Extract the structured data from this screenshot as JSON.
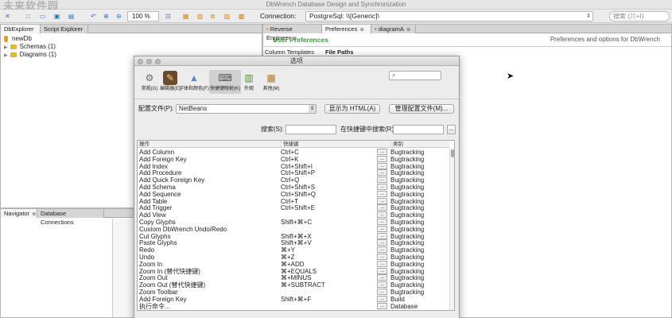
{
  "window": {
    "title": "DbWrench Database Design and Synchronization",
    "watermark": "未来软件园"
  },
  "toolbar": {
    "zoom_value": "100 %",
    "connection_label": "Connection:",
    "connection_value": "PostgreSql: \\\\[Generic]\\",
    "search_placeholder": "搜索 (⌘+I)"
  },
  "left_top_panel": {
    "tabs": [
      {
        "label": "DbExplorer"
      },
      {
        "label": "Script Explorer"
      }
    ],
    "tree": {
      "db": "newDb",
      "schemas": "Schemas (1)",
      "diagrams": "Diagrams (1)"
    }
  },
  "left_bottom_panel": {
    "tabs": [
      {
        "label": "Navigator"
      },
      {
        "label": "Database Connections"
      }
    ]
  },
  "right_panel": {
    "tabs": [
      {
        "label": "Reverse Engineer"
      },
      {
        "label": "Preferences"
      },
      {
        "label": "diagramA"
      }
    ],
    "title": "User Preferences",
    "subtitle": "Preferences and options for DbWrench",
    "col1": "Column Templates",
    "col2": "File Paths"
  },
  "dialog": {
    "title": "选项",
    "categories": [
      {
        "label": "常规(G)"
      },
      {
        "label": "编辑器(E)"
      },
      {
        "label": "字体和颜色(F)"
      },
      {
        "label": "快捷键映射(K)"
      },
      {
        "label": "外观"
      },
      {
        "label": "其他(M)"
      }
    ],
    "profile_label": "配置文件(P):",
    "profile_value": "NetBeans",
    "show_html_button": "显示为 HTML(A)",
    "manage_profiles_button": "管理配置文件(M)...",
    "search_label": "搜索(S):",
    "search_shortcut_label": "在快捷键中搜索(R):",
    "more_button": "...",
    "columns": {
      "action": "操作",
      "shortcut": "快捷键",
      "category": "类别"
    },
    "rows": [
      {
        "action": "Add Column",
        "shortcut": "Ctrl+C",
        "category": "Bugtracking"
      },
      {
        "action": "Add Foreign Key",
        "shortcut": "Ctrl+K",
        "category": "Bugtracking"
      },
      {
        "action": "Add Index",
        "shortcut": "Ctrl+Shift+I",
        "category": "Bugtracking"
      },
      {
        "action": "Add Procedure",
        "shortcut": "Ctrl+Shift+P",
        "category": "Bugtracking"
      },
      {
        "action": "Add Quick Foreign Key",
        "shortcut": "Ctrl+Q",
        "category": "Bugtracking"
      },
      {
        "action": "Add Schema",
        "shortcut": "Ctrl+Shift+S",
        "category": "Bugtracking"
      },
      {
        "action": "Add Sequence",
        "shortcut": "Ctrl+Shift+Q",
        "category": "Bugtracking"
      },
      {
        "action": "Add Table",
        "shortcut": "Ctrl+T",
        "category": "Bugtracking"
      },
      {
        "action": "Add Trigger",
        "shortcut": "Ctrl+Shift+E",
        "category": "Bugtracking"
      },
      {
        "action": "Add View",
        "shortcut": "",
        "category": "Bugtracking"
      },
      {
        "action": "Copy Glyphs",
        "shortcut": "Shift+⌘+C",
        "category": "Bugtracking"
      },
      {
        "action": "Custom DbWrench Undo/Redo",
        "shortcut": "",
        "category": "Bugtracking"
      },
      {
        "action": "Cut Glyphs",
        "shortcut": "Shift+⌘+X",
        "category": "Bugtracking"
      },
      {
        "action": "Paste Glyphs",
        "shortcut": "Shift+⌘+V",
        "category": "Bugtracking"
      },
      {
        "action": "Redo",
        "shortcut": "⌘+Y",
        "category": "Bugtracking"
      },
      {
        "action": "Undo",
        "shortcut": "⌘+Z",
        "category": "Bugtracking"
      },
      {
        "action": "Zoom In",
        "shortcut": "⌘+ADD",
        "category": "Bugtracking"
      },
      {
        "action": "Zoom In (替代快捷键)",
        "shortcut": "⌘+EQUALS",
        "category": "Bugtracking"
      },
      {
        "action": "Zoom Out",
        "shortcut": "⌘+MINUS",
        "category": "Bugtracking"
      },
      {
        "action": "Zoom Out (替代快捷键)",
        "shortcut": "⌘+SUBTRACT",
        "category": "Bugtracking"
      },
      {
        "action": "Zoom Toolbar",
        "shortcut": "",
        "category": "Bugtracking"
      },
      {
        "action": "Add Foreign Key",
        "shortcut": "Shift+⌘+F",
        "category": "Build"
      },
      {
        "action": "执行命令...",
        "shortcut": "",
        "category": "Database"
      }
    ]
  }
}
